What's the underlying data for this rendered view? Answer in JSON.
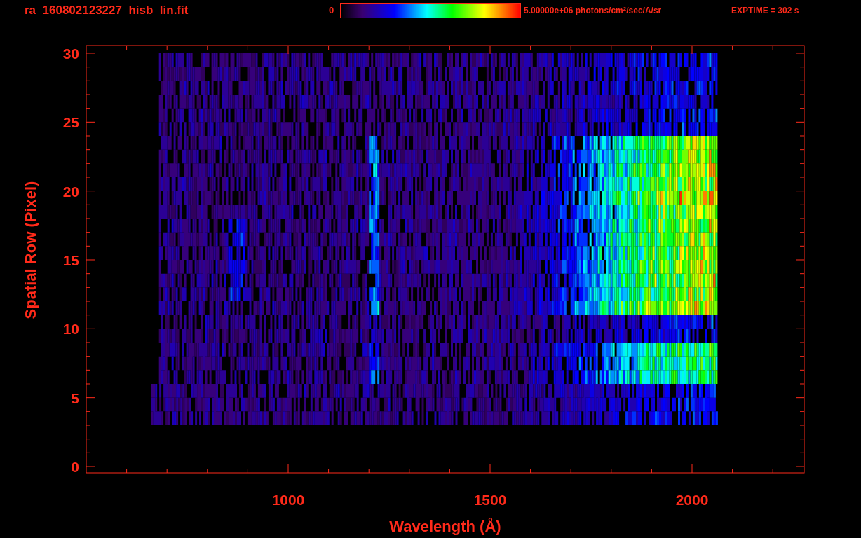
{
  "header": {
    "filename": "ra_160802123227_hisb_lin.fit",
    "colorbar_min": "0",
    "colorbar_max": "5.00000e+06 photons/cm$^{2}$/sec/A/sr",
    "exptime": "EXPTIME = 302 s"
  },
  "plot": {
    "xlabel": "Wavelength (Å)",
    "ylabel": "Spatial Row (Pixel)",
    "xticks": [
      "1000",
      "1500",
      "2000"
    ],
    "yticks": [
      "30",
      "25",
      "20",
      "15",
      "10",
      "5",
      "0"
    ]
  }
}
